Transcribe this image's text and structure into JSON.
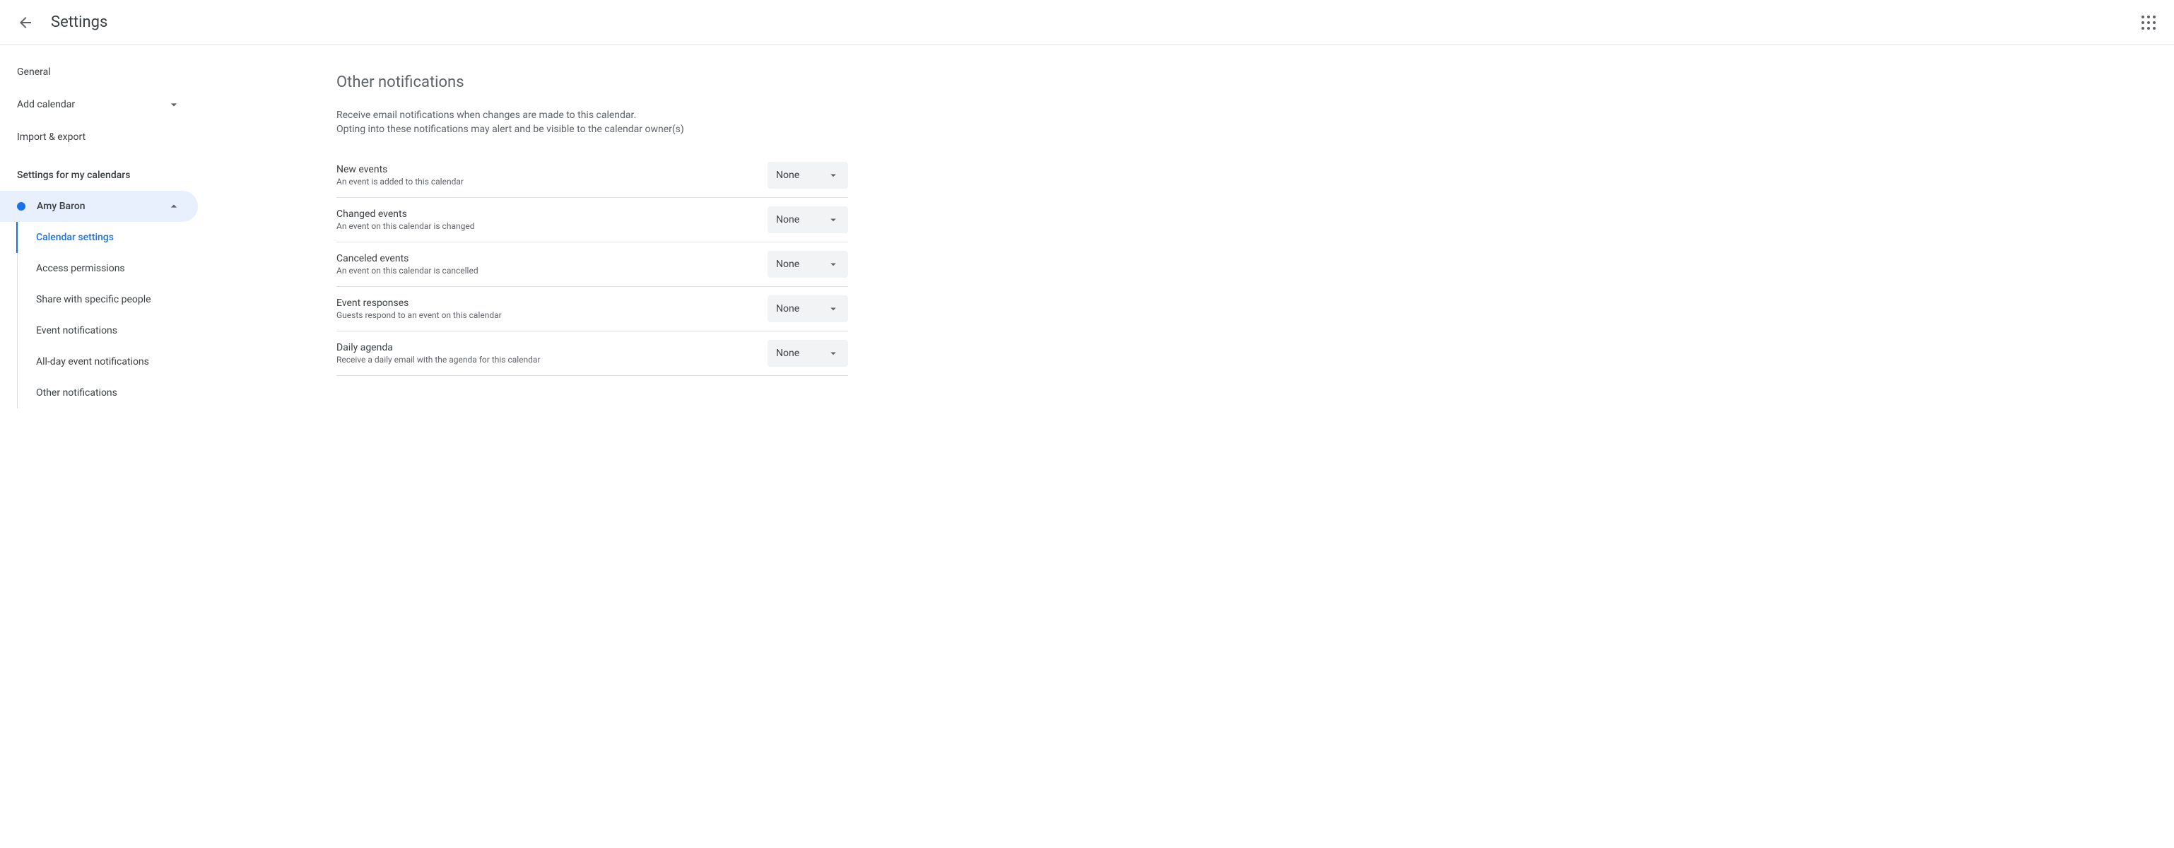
{
  "header": {
    "title": "Settings"
  },
  "sidebar": {
    "general": "General",
    "add_calendar": "Add calendar",
    "import_export": "Import & export",
    "settings_heading": "Settings for my calendars",
    "calendar_name": "Amy Baron",
    "subnav": {
      "calendar_settings": "Calendar settings",
      "access_permissions": "Access permissions",
      "share_people": "Share with specific people",
      "event_notifications": "Event notifications",
      "allday_notifications": "All-day event notifications",
      "other_notifications": "Other notifications"
    }
  },
  "main": {
    "section_title": "Other notifications",
    "section_desc_1": "Receive email notifications when changes are made to this calendar.",
    "section_desc_2": "Opting into these notifications may alert and be visible to the calendar owner(s)",
    "notifications": [
      {
        "title": "New events",
        "subtitle": "An event is added to this calendar",
        "value": "None"
      },
      {
        "title": "Changed events",
        "subtitle": "An event on this calendar is changed",
        "value": "None"
      },
      {
        "title": "Canceled events",
        "subtitle": "An event on this calendar is cancelled",
        "value": "None"
      },
      {
        "title": "Event responses",
        "subtitle": "Guests respond to an event on this calendar",
        "value": "None"
      },
      {
        "title": "Daily agenda",
        "subtitle": "Receive a daily email with the agenda for this calendar",
        "value": "None"
      }
    ]
  }
}
